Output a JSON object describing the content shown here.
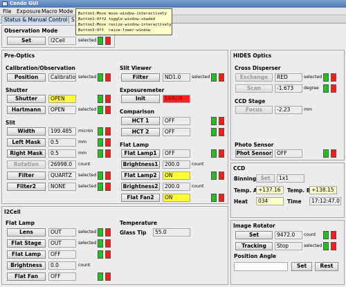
{
  "window": {
    "title": "Cendo GUI"
  },
  "menu": [
    "File",
    "Exposure",
    "Macro",
    "Mode"
  ],
  "tabs": [
    "Status & Manual Control",
    "S"
  ],
  "tooltip": {
    "lines": [
      "Button1-Move move-window-interactively",
      "Button1-Off2 toggle-window-shaded",
      "Button2-Move resize-window-interactively",
      "Button3-Off  raise-lower-window"
    ]
  },
  "colors": {
    "on_indicator": "#20c020",
    "off_indicator": "#ff1a1a",
    "highlight_yellow": "#ffff33",
    "alert_red": "#ff2020"
  },
  "observation_mode": {
    "title": "Observation Mode",
    "button": "Set",
    "value": "I2Cell",
    "status": "selected"
  },
  "pre_optics": {
    "title": "Pre-Optics",
    "calibration": {
      "title": "Calibration/Observation",
      "button": "Position",
      "value": "Calibration",
      "status": "selected"
    },
    "shutter": {
      "title": "Shutter",
      "rows": [
        {
          "button": "Shutter",
          "value": "OPEN",
          "status": ""
        },
        {
          "button": "Hartmann",
          "value": "OPEN",
          "status": "selected"
        }
      ]
    },
    "slit": {
      "title": "Slit",
      "rows": [
        {
          "button": "Width",
          "value": "199.485",
          "unit": "micron"
        },
        {
          "button": "Left Mask",
          "value": "0.5",
          "unit": "mm"
        },
        {
          "button": "Right Mask",
          "value": "0.5",
          "unit": "mm"
        },
        {
          "button": "Rotation",
          "value": "26998.0",
          "unit": "count"
        },
        {
          "button": "Filter",
          "value": "QUARTZ",
          "unit": "selected"
        },
        {
          "button": "Filter2",
          "value": "NONE",
          "unit": "selected"
        }
      ]
    },
    "slit_viewer": {
      "title": "Slit Viewer",
      "button": "Filter",
      "value": "ND1.0",
      "status": "selected"
    },
    "exposuremeter": {
      "title": "Exposuremeter",
      "button": "Init",
      "value": "ERROR"
    },
    "comparison": {
      "title": "Comparison",
      "rows": [
        {
          "button": "HCT 1",
          "value": "OFF"
        },
        {
          "button": "HCT 2",
          "value": "OFF"
        }
      ]
    },
    "flat_lamp": {
      "title": "Flat Lamp",
      "rows": [
        {
          "button": "Flat Lamp1",
          "value": "OFF",
          "unit": ""
        },
        {
          "button": "Brightness1",
          "value": "200.0",
          "unit": "count"
        },
        {
          "button": "Flat Lamp2",
          "value": "ON",
          "unit": ""
        },
        {
          "button": "Brightness2",
          "value": "200.0",
          "unit": "count"
        },
        {
          "button": "Flat Fan2",
          "value": "ON",
          "unit": ""
        }
      ]
    }
  },
  "i2cell": {
    "title": "I2Cell",
    "flat_lamp": {
      "title": "Flat Lamp",
      "rows": [
        {
          "button": "Lens",
          "value": "OUT",
          "unit": "selected"
        },
        {
          "button": "Flat Stage",
          "value": "OUT",
          "unit": "selected"
        },
        {
          "button": "Flat Lamp",
          "value": "OFF",
          "unit": ""
        },
        {
          "button": "Brightness",
          "value": "0.0",
          "unit": "count"
        },
        {
          "button": "Flat Fan",
          "value": "OFF",
          "unit": ""
        }
      ]
    },
    "temperature": {
      "title": "Temperature",
      "label": "Glass Tip",
      "value": "55.0"
    }
  },
  "hides_optics": {
    "title": "HIDES Optics",
    "cross_disperser": {
      "title": "Cross Disperser",
      "rows": [
        {
          "button": "Exchange",
          "value": "RED",
          "unit": "selected"
        },
        {
          "button": "Scan",
          "value": "-1.673",
          "unit": "degree"
        }
      ]
    },
    "ccd_stage": {
      "title": "CCD Stage",
      "button": "Focus",
      "value": "-2.23",
      "unit": "mm"
    },
    "photo_sensor": {
      "title": "Photo Sensor",
      "button": "Phot Sensor",
      "value": "OFF"
    }
  },
  "ccd": {
    "title": "CCD",
    "binning": {
      "label": "Binning",
      "button": "Set",
      "value": "1x1"
    },
    "temp_a": {
      "label": "Temp. A",
      "value": "+137.16"
    },
    "temp_b": {
      "label": "Temp. B",
      "value": "+138.15"
    },
    "heat": {
      "label": "Heat",
      "value": "034"
    },
    "time": {
      "label": "Time",
      "value": "17:12:47.0"
    }
  },
  "image_rotator": {
    "title": "Image Rotator",
    "rows": [
      {
        "button": "Set",
        "value": "9472.0",
        "unit": "count"
      },
      {
        "button": "Tracking",
        "value": "Stop",
        "unit": "selected"
      }
    ],
    "position_angle": {
      "label": "Position Angle",
      "value": "",
      "set": "Set",
      "rest": "Rest"
    }
  }
}
